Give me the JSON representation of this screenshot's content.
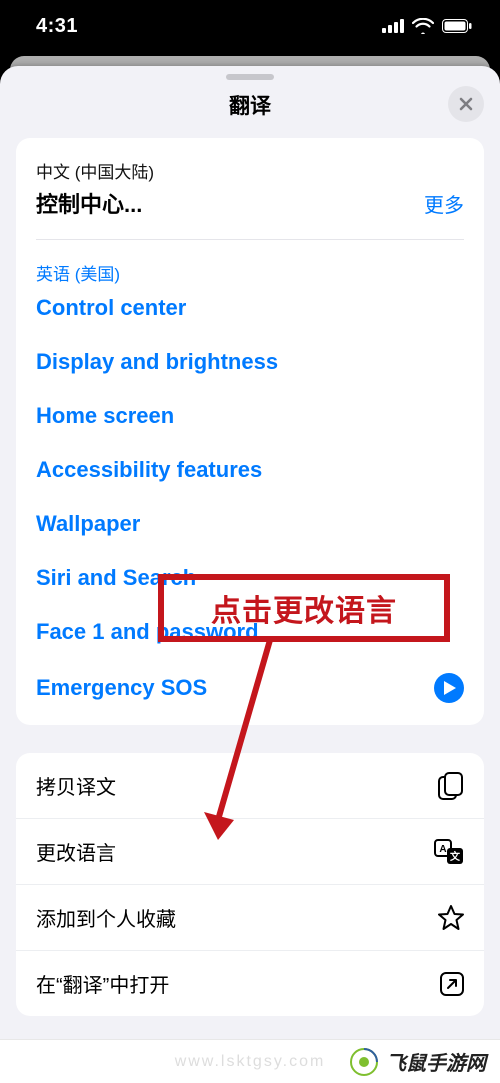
{
  "status": {
    "time": "4:31"
  },
  "sheet": {
    "title": "翻译",
    "source_lang": "中文 (中国大陆)",
    "source_text": "控制中心...",
    "more_label": "更多",
    "dest_lang": "英语 (美国)",
    "translations": [
      "Control center",
      "Display and brightness",
      "Home screen",
      "Accessibility features",
      "Wallpaper",
      "Siri and Search",
      "Face 1 and password",
      "Emergency SOS"
    ],
    "actions": {
      "copy": "拷贝译文",
      "change_lang": "更改语言",
      "add_fav": "添加到个人收藏",
      "open_in": "在“翻译”中打开"
    }
  },
  "annotation": {
    "text": "点击更改语言"
  },
  "watermark": {
    "faint": "www.lsktgsy.com",
    "brand": "飞鼠手游网"
  }
}
